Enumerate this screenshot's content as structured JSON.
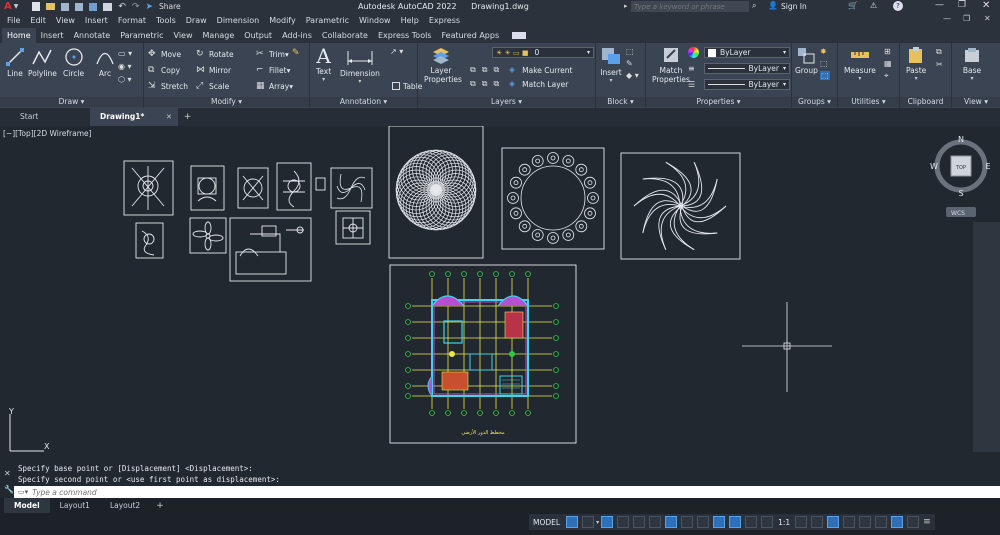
{
  "title": {
    "app": "Autodesk AutoCAD 2022",
    "file": "Drawing1.dwg",
    "share": "Share",
    "search_placeholder": "Type a keyword or phrase",
    "sign_in": "Sign In"
  },
  "menu": [
    "File",
    "Edit",
    "View",
    "Insert",
    "Format",
    "Tools",
    "Draw",
    "Dimension",
    "Modify",
    "Parametric",
    "Window",
    "Help",
    "Express"
  ],
  "ribbon_tabs": [
    "Home",
    "Insert",
    "Annotate",
    "Parametric",
    "View",
    "Manage",
    "Output",
    "Add-ins",
    "Collaborate",
    "Express Tools",
    "Featured Apps"
  ],
  "ribbon": {
    "draw": {
      "label": "Draw",
      "line": "Line",
      "polyline": "Polyline",
      "circle": "Circle",
      "arc": "Arc"
    },
    "modify": {
      "label": "Modify",
      "move": "Move",
      "rotate": "Rotate",
      "trim": "Trim",
      "copy": "Copy",
      "mirror": "Mirror",
      "fillet": "Fillet",
      "stretch": "Stretch",
      "scale": "Scale",
      "array": "Array"
    },
    "annotation": {
      "label": "Annotation",
      "text": "Text",
      "dimension": "Dimension",
      "table": "Table"
    },
    "layers": {
      "label": "Layers",
      "layer_properties_1": "Layer",
      "layer_properties_2": "Properties",
      "current_layer": "0",
      "make_current": "Make Current",
      "match_layer": "Match Layer"
    },
    "block": {
      "label": "Block",
      "insert": "Insert"
    },
    "properties": {
      "label": "Properties",
      "match_1": "Match",
      "match_2": "Properties",
      "color": "ByLayer",
      "linetype": "ByLayer",
      "lineweight": "ByLayer"
    },
    "groups": {
      "label": "Groups",
      "group": "Group"
    },
    "utilities": {
      "label": "Utilities",
      "measure": "Measure"
    },
    "clipboard": {
      "label": "Clipboard",
      "paste": "Paste"
    },
    "view": {
      "label": "View",
      "base": "Base"
    }
  },
  "doc_tabs": {
    "start": "Start",
    "drawing": "Drawing1*"
  },
  "viewport": {
    "label": "[−][Top][2D Wireframe]",
    "cube_top": "TOP",
    "north": "N",
    "south": "S",
    "east": "E",
    "west": "W",
    "wcs": "WCS",
    "x_axis": "X",
    "y_axis": "Y"
  },
  "command": {
    "line1": "Specify base point or [Displacement] <Displacement>:",
    "line2": "Specify second point or <use first point as displacement>:",
    "placeholder": "Type a command"
  },
  "layout_tabs": [
    "Model",
    "Layout1",
    "Layout2"
  ],
  "status": {
    "model": "MODEL",
    "scale": "1:1"
  },
  "plan_caption": "مخطط الدور الأرضي",
  "colors": {
    "accent": "#2f6fb6",
    "canvas": "#212830",
    "ribbon": "#3b4452",
    "green_grid": "#2ecc40",
    "yellow_grid": "#e8e84a"
  }
}
